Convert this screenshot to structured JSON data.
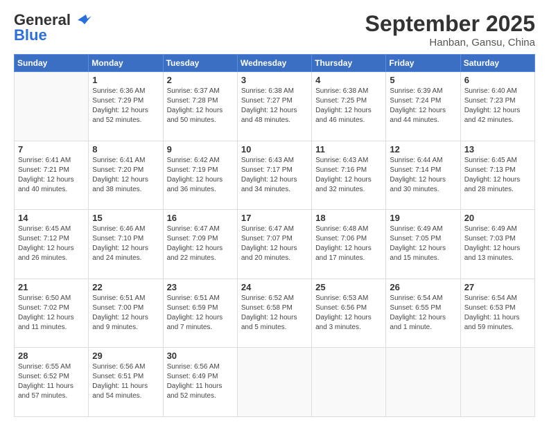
{
  "header": {
    "logo_general": "General",
    "logo_blue": "Blue",
    "month_year": "September 2025",
    "location": "Hanban, Gansu, China"
  },
  "days_of_week": [
    "Sunday",
    "Monday",
    "Tuesday",
    "Wednesday",
    "Thursday",
    "Friday",
    "Saturday"
  ],
  "weeks": [
    [
      {
        "day": "",
        "info": ""
      },
      {
        "day": "1",
        "info": "Sunrise: 6:36 AM\nSunset: 7:29 PM\nDaylight: 12 hours\nand 52 minutes."
      },
      {
        "day": "2",
        "info": "Sunrise: 6:37 AM\nSunset: 7:28 PM\nDaylight: 12 hours\nand 50 minutes."
      },
      {
        "day": "3",
        "info": "Sunrise: 6:38 AM\nSunset: 7:27 PM\nDaylight: 12 hours\nand 48 minutes."
      },
      {
        "day": "4",
        "info": "Sunrise: 6:38 AM\nSunset: 7:25 PM\nDaylight: 12 hours\nand 46 minutes."
      },
      {
        "day": "5",
        "info": "Sunrise: 6:39 AM\nSunset: 7:24 PM\nDaylight: 12 hours\nand 44 minutes."
      },
      {
        "day": "6",
        "info": "Sunrise: 6:40 AM\nSunset: 7:23 PM\nDaylight: 12 hours\nand 42 minutes."
      }
    ],
    [
      {
        "day": "7",
        "info": "Sunrise: 6:41 AM\nSunset: 7:21 PM\nDaylight: 12 hours\nand 40 minutes."
      },
      {
        "day": "8",
        "info": "Sunrise: 6:41 AM\nSunset: 7:20 PM\nDaylight: 12 hours\nand 38 minutes."
      },
      {
        "day": "9",
        "info": "Sunrise: 6:42 AM\nSunset: 7:19 PM\nDaylight: 12 hours\nand 36 minutes."
      },
      {
        "day": "10",
        "info": "Sunrise: 6:43 AM\nSunset: 7:17 PM\nDaylight: 12 hours\nand 34 minutes."
      },
      {
        "day": "11",
        "info": "Sunrise: 6:43 AM\nSunset: 7:16 PM\nDaylight: 12 hours\nand 32 minutes."
      },
      {
        "day": "12",
        "info": "Sunrise: 6:44 AM\nSunset: 7:14 PM\nDaylight: 12 hours\nand 30 minutes."
      },
      {
        "day": "13",
        "info": "Sunrise: 6:45 AM\nSunset: 7:13 PM\nDaylight: 12 hours\nand 28 minutes."
      }
    ],
    [
      {
        "day": "14",
        "info": "Sunrise: 6:45 AM\nSunset: 7:12 PM\nDaylight: 12 hours\nand 26 minutes."
      },
      {
        "day": "15",
        "info": "Sunrise: 6:46 AM\nSunset: 7:10 PM\nDaylight: 12 hours\nand 24 minutes."
      },
      {
        "day": "16",
        "info": "Sunrise: 6:47 AM\nSunset: 7:09 PM\nDaylight: 12 hours\nand 22 minutes."
      },
      {
        "day": "17",
        "info": "Sunrise: 6:47 AM\nSunset: 7:07 PM\nDaylight: 12 hours\nand 20 minutes."
      },
      {
        "day": "18",
        "info": "Sunrise: 6:48 AM\nSunset: 7:06 PM\nDaylight: 12 hours\nand 17 minutes."
      },
      {
        "day": "19",
        "info": "Sunrise: 6:49 AM\nSunset: 7:05 PM\nDaylight: 12 hours\nand 15 minutes."
      },
      {
        "day": "20",
        "info": "Sunrise: 6:49 AM\nSunset: 7:03 PM\nDaylight: 12 hours\nand 13 minutes."
      }
    ],
    [
      {
        "day": "21",
        "info": "Sunrise: 6:50 AM\nSunset: 7:02 PM\nDaylight: 12 hours\nand 11 minutes."
      },
      {
        "day": "22",
        "info": "Sunrise: 6:51 AM\nSunset: 7:00 PM\nDaylight: 12 hours\nand 9 minutes."
      },
      {
        "day": "23",
        "info": "Sunrise: 6:51 AM\nSunset: 6:59 PM\nDaylight: 12 hours\nand 7 minutes."
      },
      {
        "day": "24",
        "info": "Sunrise: 6:52 AM\nSunset: 6:58 PM\nDaylight: 12 hours\nand 5 minutes."
      },
      {
        "day": "25",
        "info": "Sunrise: 6:53 AM\nSunset: 6:56 PM\nDaylight: 12 hours\nand 3 minutes."
      },
      {
        "day": "26",
        "info": "Sunrise: 6:54 AM\nSunset: 6:55 PM\nDaylight: 12 hours\nand 1 minute."
      },
      {
        "day": "27",
        "info": "Sunrise: 6:54 AM\nSunset: 6:53 PM\nDaylight: 11 hours\nand 59 minutes."
      }
    ],
    [
      {
        "day": "28",
        "info": "Sunrise: 6:55 AM\nSunset: 6:52 PM\nDaylight: 11 hours\nand 57 minutes."
      },
      {
        "day": "29",
        "info": "Sunrise: 6:56 AM\nSunset: 6:51 PM\nDaylight: 11 hours\nand 54 minutes."
      },
      {
        "day": "30",
        "info": "Sunrise: 6:56 AM\nSunset: 6:49 PM\nDaylight: 11 hours\nand 52 minutes."
      },
      {
        "day": "",
        "info": ""
      },
      {
        "day": "",
        "info": ""
      },
      {
        "day": "",
        "info": ""
      },
      {
        "day": "",
        "info": ""
      }
    ]
  ]
}
